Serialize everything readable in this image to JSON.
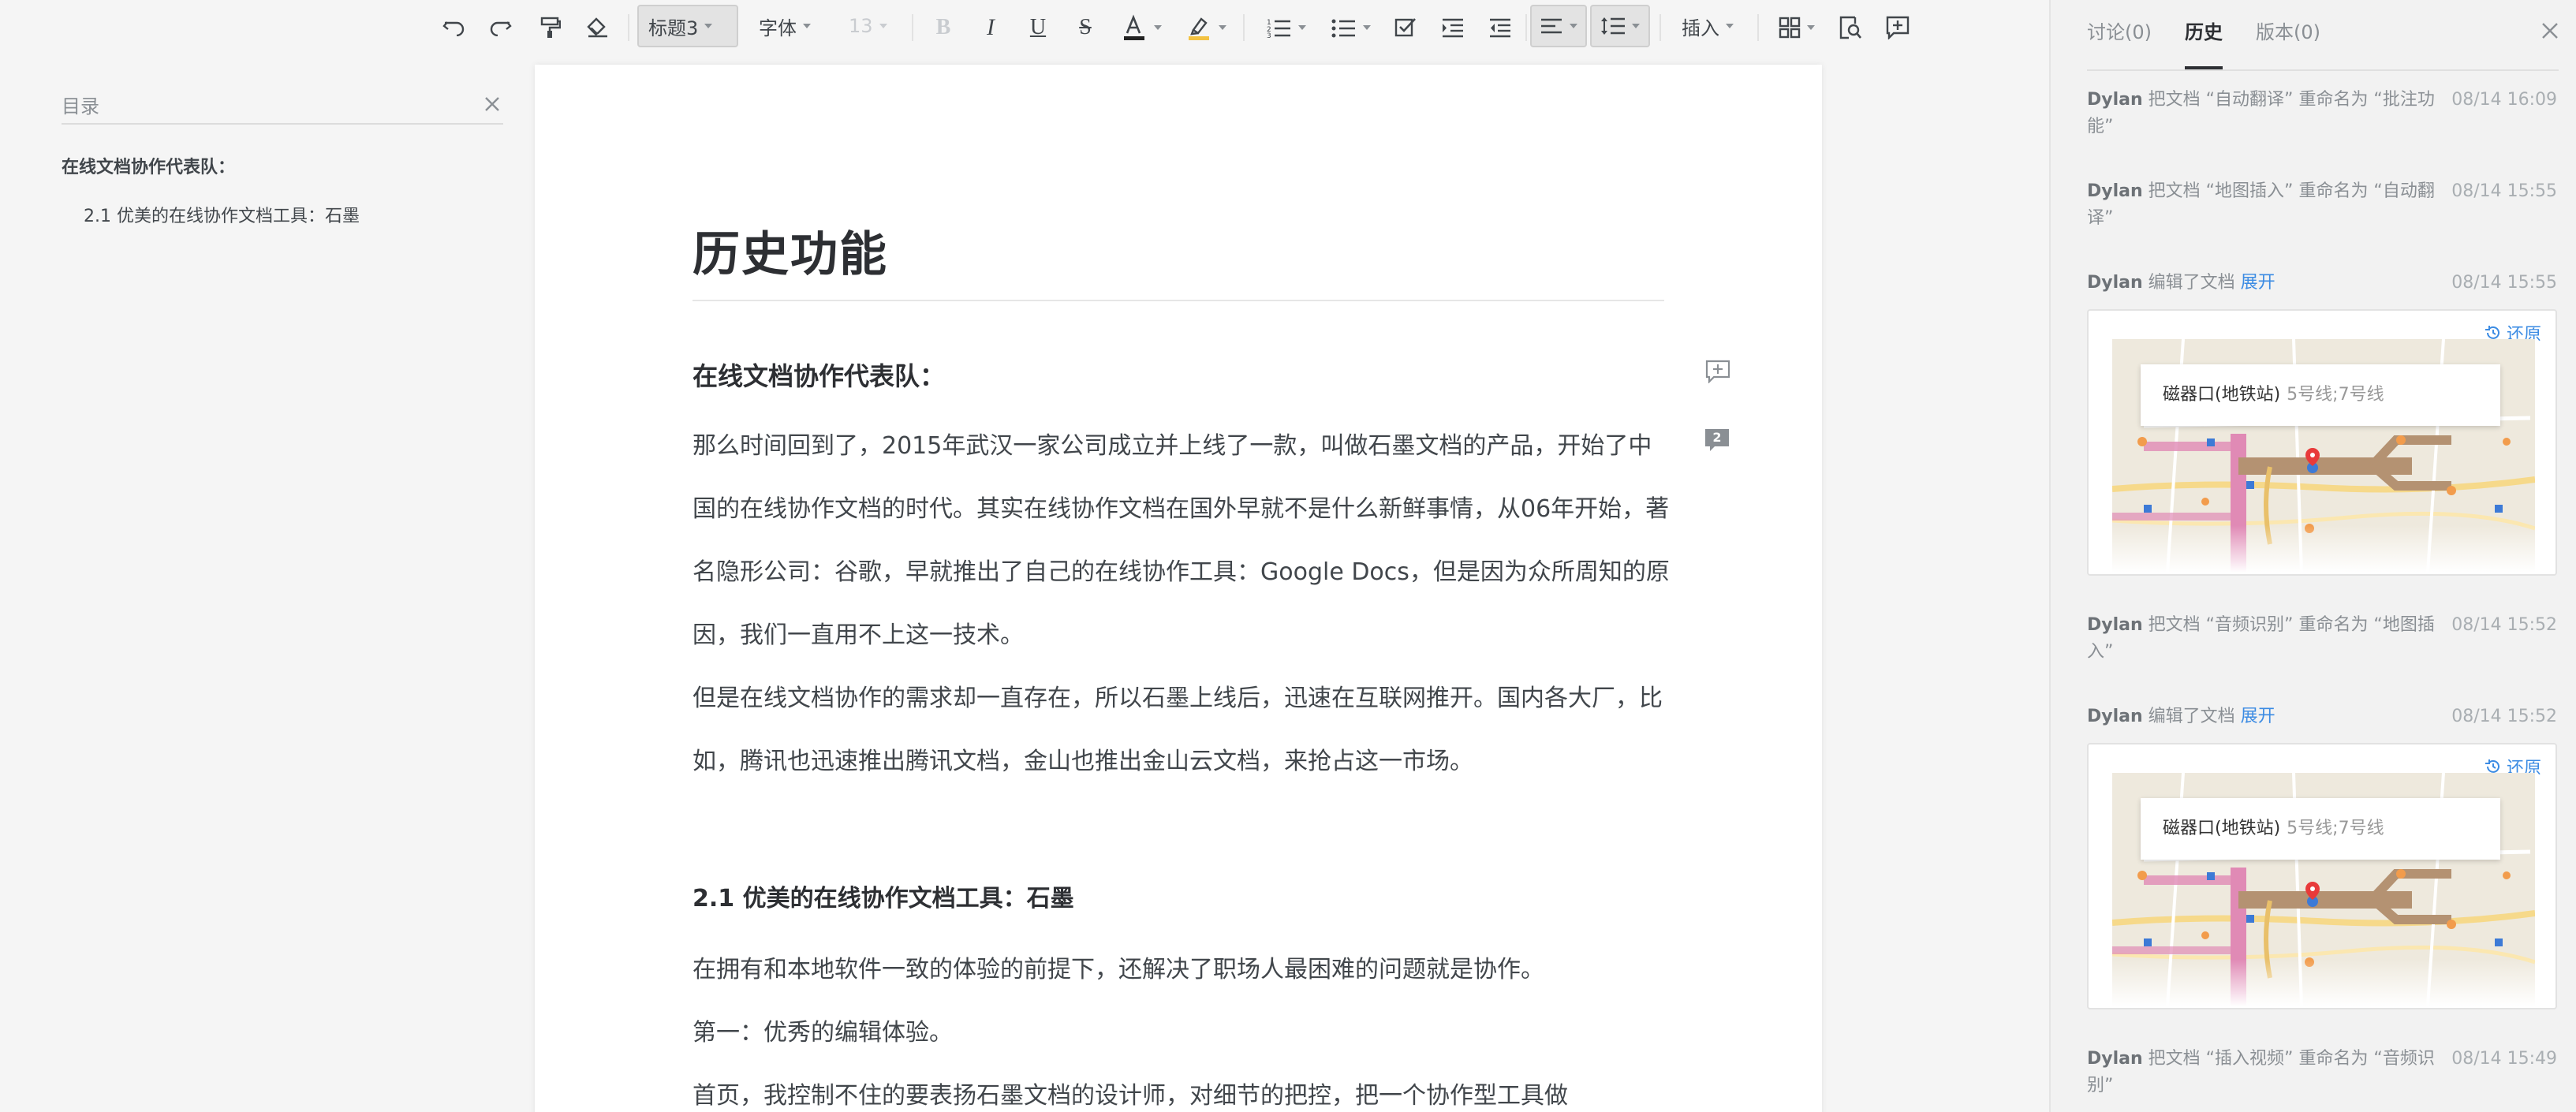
{
  "toolbar": {
    "heading_style": "标题3",
    "font": "字体",
    "font_size": "13",
    "insert": "插入",
    "accent_text_color": "#222222",
    "highlight_color": "#f3c242"
  },
  "toc": {
    "title": "目录",
    "items": [
      {
        "label": "在线文档协作代表队："
      },
      {
        "label": "2.1 优美的在线协作文档工具：石墨"
      }
    ]
  },
  "document": {
    "title": "历史功能",
    "section1_heading": "在线文档协作代表队：",
    "para1": "那么时间回到了，2015年武汉一家公司成立并上线了一款，叫做石墨文档的产品，开始了中国的在线协作文档的时代。其实在线协作文档在国外早就不是什么新鲜事情，从06年开始，著名隐形公司：谷歌，早就推出了自己的在线协作工具：Google Docs，但是因为众所周知的原因，我们一直用不上这一技术。",
    "para2": "但是在线文档协作的需求却一直存在，所以石墨上线后，迅速在互联网推开。国内各大厂，比如，腾讯也迅速推出腾讯文档，金山也推出金山云文档，来抢占这一市场。",
    "section2_heading": "2.1 优美的在线协作文档工具：石墨",
    "para3": "在拥有和本地软件一致的体验的前提下，还解决了职场人最困难的问题就是协作。",
    "para4": "第一：优秀的编辑体验。",
    "para5": "首页，我控制不住的要表扬石墨文档的设计师，对细节的把控，把一个协作型工具做",
    "comment_count": "2"
  },
  "panel": {
    "tabs": [
      {
        "label": "讨论(0)"
      },
      {
        "label": "历史"
      },
      {
        "label": "版本(0)"
      }
    ],
    "history": [
      {
        "user": "Dylan",
        "text": "把文档 “自动翻译” 重命名为 “批注功能”",
        "time": "08/14 16:09"
      },
      {
        "user": "Dylan",
        "text": "把文档 “地图插入” 重命名为 “自动翻译”",
        "time": "08/14 15:55"
      },
      {
        "user": "Dylan",
        "text": "编辑了文档",
        "link": "展开",
        "time": "08/14 15:55"
      },
      {
        "user": "Dylan",
        "text": "把文档 “音频识别” 重命名为 “地图插入”",
        "time": "08/14 15:52"
      },
      {
        "user": "Dylan",
        "text": "编辑了文档",
        "link": "展开",
        "time": "08/14 15:52"
      },
      {
        "user": "Dylan",
        "text": "把文档 “插入视频” 重命名为 “音频识别”",
        "time": "08/14 15:49"
      }
    ],
    "cards": [
      {
        "restore": "还原",
        "station": "磁器口(地铁站)",
        "lines": "5号线;7号线"
      },
      {
        "restore": "还原",
        "station": "磁器口(地铁站)",
        "lines": "5号线;7号线"
      }
    ],
    "link_color": "#3b8be3"
  }
}
